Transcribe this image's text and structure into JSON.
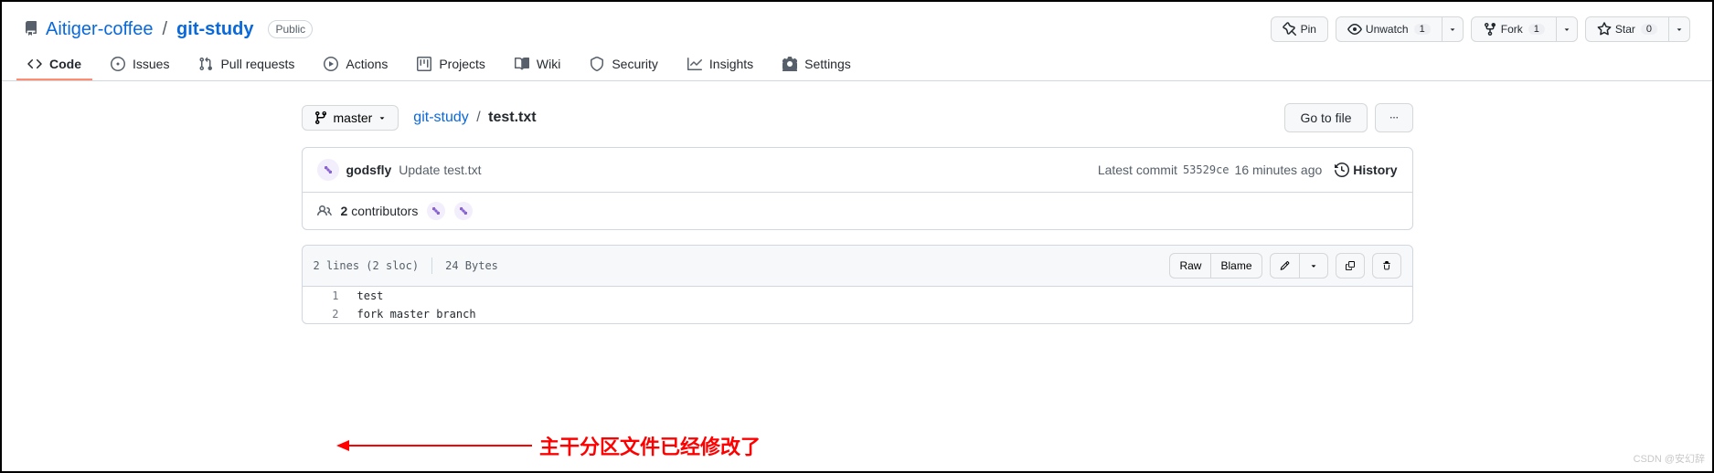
{
  "header": {
    "owner": "Aitiger-coffee",
    "repo": "git-study",
    "visibility": "Public",
    "pin_label": "Pin",
    "unwatch_label": "Unwatch",
    "unwatch_count": "1",
    "fork_label": "Fork",
    "fork_count": "1",
    "star_label": "Star",
    "star_count": "0"
  },
  "tabs": {
    "code": "Code",
    "issues": "Issues",
    "pulls": "Pull requests",
    "actions": "Actions",
    "projects": "Projects",
    "wiki": "Wiki",
    "security": "Security",
    "insights": "Insights",
    "settings": "Settings"
  },
  "filepath": {
    "branch": "master",
    "root": "git-study",
    "file": "test.txt",
    "go_to_file": "Go to file"
  },
  "commit": {
    "author": "godsfly",
    "message": "Update test.txt",
    "latest_label": "Latest commit",
    "sha": "53529ce",
    "time": "16 minutes ago",
    "history": "History"
  },
  "contributors": {
    "count": "2",
    "label": "contributors"
  },
  "file": {
    "lines_info": "2 lines (2 sloc)",
    "bytes": "24 Bytes",
    "raw": "Raw",
    "blame": "Blame",
    "code_lines": [
      {
        "n": "1",
        "text": "test"
      },
      {
        "n": "2",
        "text": "fork master branch"
      }
    ]
  },
  "annotation": "主干分区文件已经修改了",
  "watermark": "CSDN @安幻辞"
}
